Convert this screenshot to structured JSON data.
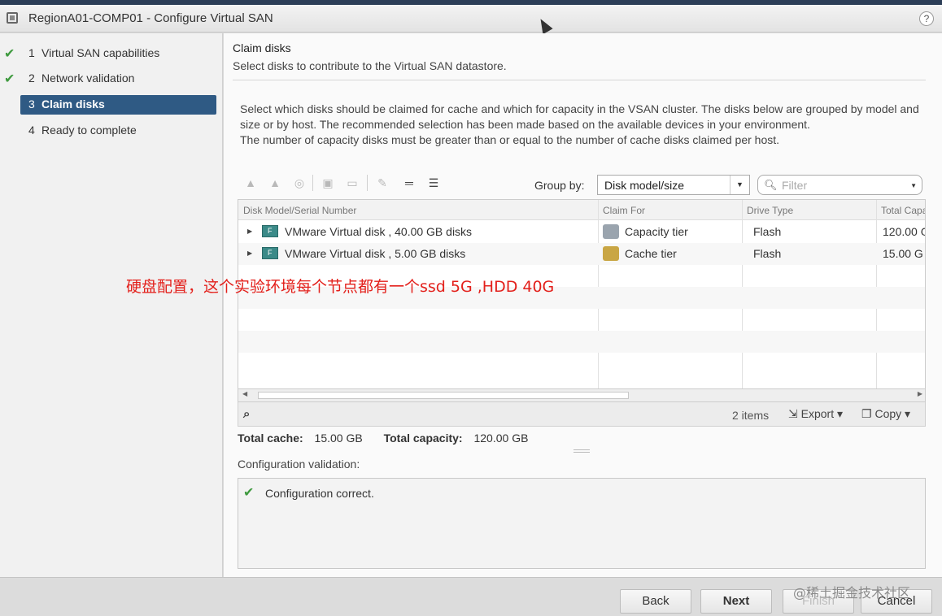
{
  "window": {
    "title": "RegionA01-COMP01 - Configure Virtual SAN",
    "help_glyph": "?"
  },
  "steps": [
    {
      "num": "1",
      "label": "Virtual SAN capabilities",
      "state": "done"
    },
    {
      "num": "2",
      "label": "Network validation",
      "state": "done"
    },
    {
      "num": "3",
      "label": "Claim disks",
      "state": "active"
    },
    {
      "num": "4",
      "label": "Ready to complete",
      "state": "pending"
    }
  ],
  "page": {
    "title": "Claim disks",
    "subtitle": "Select disks to contribute to the Virtual SAN datastore.",
    "description_1": "Select which disks should be claimed for cache and which for capacity in the VSAN cluster. The disks below are grouped by model and size or by host. The recommended selection has been made based on the available devices in your environment.",
    "description_2": "The number of capacity disks must be greater than or equal to the number of cache disks claimed per host."
  },
  "toolbar": {
    "group_by_label": "Group by:",
    "group_by_value": "Disk model/size",
    "filter_placeholder": "Filter"
  },
  "grid": {
    "columns": [
      "Disk Model/Serial Number",
      "Claim For",
      "Drive Type",
      "Total Capa"
    ],
    "rows": [
      {
        "model": "VMware    Virtual disk     , 40.00 GB disks",
        "claim_for": "Capacity tier",
        "drive_type": "Flash",
        "total": "120.00 G"
      },
      {
        "model": "VMware    Virtual disk     , 5.00 GB disks",
        "claim_for": "Cache tier",
        "drive_type": "Flash",
        "total": "15.00 G"
      }
    ],
    "item_count": "2 items",
    "export_label": "Export",
    "copy_label": "Copy"
  },
  "totals": {
    "cache_label": "Total cache:",
    "cache_value": "15.00 GB",
    "capacity_label": "Total capacity:",
    "capacity_value": "120.00 GB"
  },
  "validation": {
    "label": "Configuration validation:",
    "message": "Configuration correct."
  },
  "annotation": "硬盘配置，这个实验环境每个节点都有一个ssd 5G ,HDD 40G",
  "buttons": {
    "back": "Back",
    "next": "Next",
    "finish": "Finish",
    "cancel": "Cancel"
  },
  "watermark": "@稀土掘金技术社区",
  "colors": {
    "accent": "#2f5a84",
    "success": "#3f9a3f",
    "annotation": "#e3201b"
  }
}
